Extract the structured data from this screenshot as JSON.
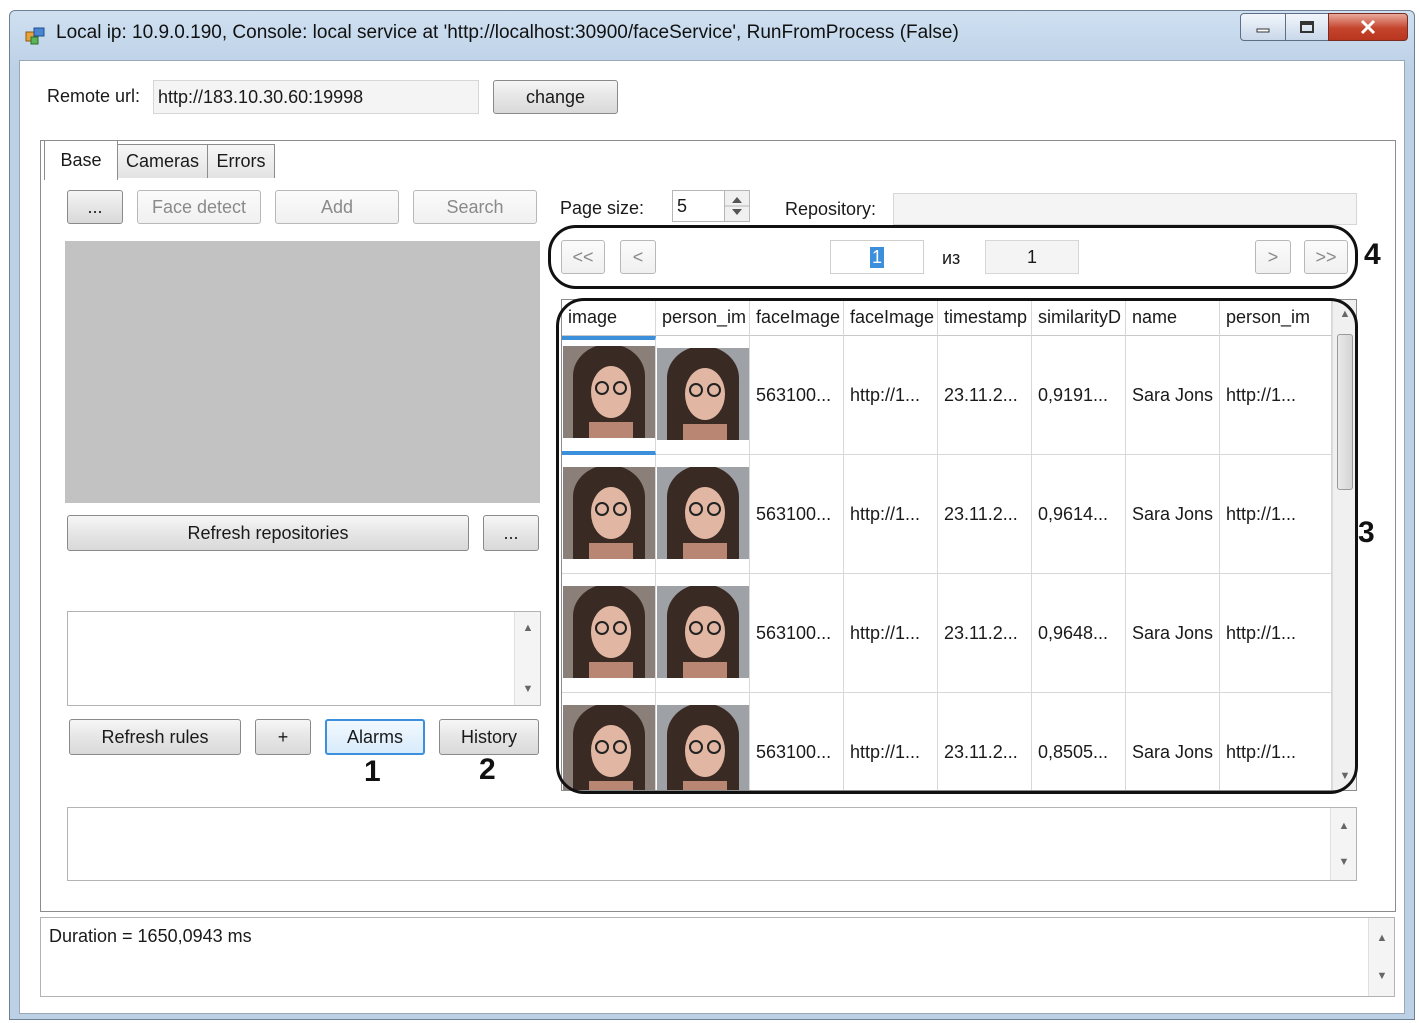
{
  "window": {
    "title": "Local ip: 10.9.0.190, Console: local service at 'http://localhost:30900/faceService', RunFromProcess (False)",
    "controls": [
      "minimize",
      "maximize",
      "close"
    ]
  },
  "remote": {
    "label": "Remote url:",
    "value": "http://183.10.30.60:19998",
    "change_label": "change"
  },
  "tabs": [
    {
      "label": "Base",
      "active": true
    },
    {
      "label": "Cameras",
      "active": false
    },
    {
      "label": "Errors",
      "active": false
    }
  ],
  "toolbar": {
    "browse_label": "...",
    "face_detect_label": "Face detect",
    "add_label": "Add",
    "search_label": "Search"
  },
  "page_size": {
    "label": "Page size:",
    "value": "5"
  },
  "repository": {
    "label": "Repository:",
    "value": ""
  },
  "pager": {
    "first_label": "<<",
    "prev_label": "<",
    "current_page": "1",
    "of_label": "из",
    "total_pages": "1",
    "next_label": ">",
    "last_label": ">>"
  },
  "repositories": {
    "refresh_label": "Refresh repositories",
    "more_label": "..."
  },
  "rules": {
    "refresh_label": "Refresh rules",
    "plus_label": "+",
    "alarms_label": "Alarms",
    "history_label": "History"
  },
  "callouts": {
    "alarms": "1",
    "history": "2",
    "grid": "3",
    "pager": "4"
  },
  "grid": {
    "columns": [
      "image",
      "person_im",
      "faceImage",
      "faceImage",
      "timestamp",
      "similarityD",
      "name",
      "person_im"
    ],
    "rows": [
      {
        "faceImage_id": "563100...",
        "faceImage_url": "http://1...",
        "timestamp": "23.11.2...",
        "similarity": "0,9191...",
        "name": "Sara Jons",
        "person_url": "http://1..."
      },
      {
        "faceImage_id": "563100...",
        "faceImage_url": "http://1...",
        "timestamp": "23.11.2...",
        "similarity": "0,9614...",
        "name": "Sara Jons",
        "person_url": "http://1..."
      },
      {
        "faceImage_id": "563100...",
        "faceImage_url": "http://1...",
        "timestamp": "23.11.2...",
        "similarity": "0,9648...",
        "name": "Sara Jons",
        "person_url": "http://1..."
      },
      {
        "faceImage_id": "563100...",
        "faceImage_url": "http://1...",
        "timestamp": "23.11.2...",
        "similarity": "0,8505...",
        "name": "Sara Jons",
        "person_url": "http://1..."
      }
    ]
  },
  "status": {
    "text": "Duration = 1650,0943 ms"
  },
  "colors": {
    "selection": "#3c8fdb",
    "callout": "#111111",
    "preview": "#c2c2c2"
  }
}
